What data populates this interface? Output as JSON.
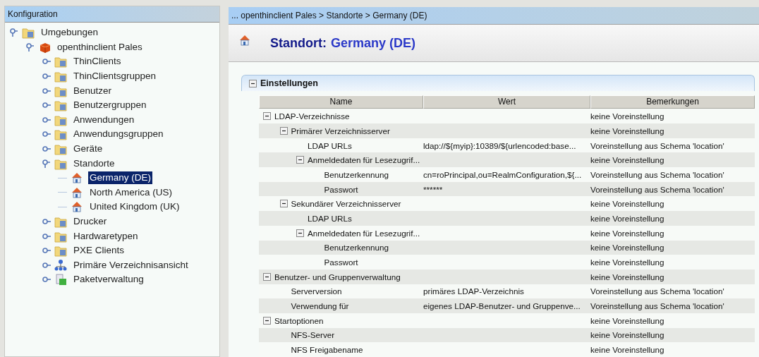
{
  "sidebar": {
    "title": "Konfiguration",
    "tree": [
      {
        "label": "Umgebungen",
        "kind": "folder",
        "expanded": true,
        "selected": false,
        "children": [
          {
            "label": "openthinclient Pales",
            "kind": "cube",
            "expanded": true,
            "selected": false,
            "children": [
              {
                "label": "ThinClients",
                "kind": "folder",
                "expanded": false,
                "selected": false
              },
              {
                "label": "ThinClientsgruppen",
                "kind": "folder",
                "expanded": false,
                "selected": false
              },
              {
                "label": "Benutzer",
                "kind": "folder",
                "expanded": false,
                "selected": false
              },
              {
                "label": "Benutzergruppen",
                "kind": "folder",
                "expanded": false,
                "selected": false
              },
              {
                "label": "Anwendungen",
                "kind": "folder",
                "expanded": false,
                "selected": false
              },
              {
                "label": "Anwendungsgruppen",
                "kind": "folder",
                "expanded": false,
                "selected": false
              },
              {
                "label": "Geräte",
                "kind": "folder",
                "expanded": false,
                "selected": false
              },
              {
                "label": "Standorte",
                "kind": "folder",
                "expanded": true,
                "selected": false,
                "children": [
                  {
                    "label": "Germany (DE)",
                    "kind": "house",
                    "selected": true
                  },
                  {
                    "label": "North America (US)",
                    "kind": "house",
                    "selected": false
                  },
                  {
                    "label": "United Kingdom (UK)",
                    "kind": "house",
                    "selected": false
                  }
                ]
              },
              {
                "label": "Drucker",
                "kind": "folder",
                "expanded": false,
                "selected": false
              },
              {
                "label": "Hardwaretypen",
                "kind": "folder",
                "expanded": false,
                "selected": false
              },
              {
                "label": "PXE Clients",
                "kind": "folder",
                "expanded": false,
                "selected": false
              },
              {
                "label": "Primäre Verzeichnisansicht",
                "kind": "hierarchy",
                "expanded": false,
                "selected": false
              },
              {
                "label": "Paketverwaltung",
                "kind": "package",
                "expanded": false,
                "selected": false
              }
            ]
          }
        ]
      }
    ]
  },
  "breadcrumb": "... openthinclient Pales > Standorte > Germany (DE)",
  "header": {
    "label": "Standort:",
    "value": "Germany (DE)"
  },
  "settings": {
    "title": "Einstellungen",
    "expanded": true,
    "table": {
      "columns": [
        "Name",
        "Wert",
        "Bemerkungen"
      ],
      "rows": [
        {
          "name": "LDAP-Verzeichnisse",
          "remark": "keine Voreinstellung",
          "expanded": true,
          "children": [
            {
              "name": "Primärer Verzeichnisserver",
              "remark": "keine Voreinstellung",
              "expanded": true,
              "children": [
                {
                  "name": "LDAP URLs",
                  "value": "ldap://${myip}:10389/${urlencoded:base...",
                  "remark": "Voreinstellung aus Schema 'location'"
                },
                {
                  "name": "Anmeldedaten für Lesezugrif...",
                  "remark": "keine Voreinstellung",
                  "expanded": true,
                  "children": [
                    {
                      "name": "Benutzerkennung",
                      "value": "cn=roPrincipal,ou=RealmConfiguration,${...",
                      "remark": "Voreinstellung aus Schema 'location'"
                    },
                    {
                      "name": "Passwort",
                      "value": "******",
                      "remark": "Voreinstellung aus Schema 'location'"
                    }
                  ]
                }
              ]
            },
            {
              "name": "Sekundärer Verzeichnisserver",
              "remark": "keine Voreinstellung",
              "expanded": true,
              "children": [
                {
                  "name": "LDAP URLs",
                  "remark": "keine Voreinstellung"
                },
                {
                  "name": "Anmeldedaten für Lesezugrif...",
                  "remark": "keine Voreinstellung",
                  "expanded": true,
                  "children": [
                    {
                      "name": "Benutzerkennung",
                      "remark": "keine Voreinstellung"
                    },
                    {
                      "name": "Passwort",
                      "remark": "keine Voreinstellung"
                    }
                  ]
                }
              ]
            }
          ]
        },
        {
          "name": "Benutzer- und Gruppenverwaltung",
          "remark": "keine Voreinstellung",
          "expanded": true,
          "children": [
            {
              "name": "Serverversion",
              "value": "primäres LDAP-Verzeichnis",
              "remark": "Voreinstellung aus Schema 'location'"
            },
            {
              "name": "Verwendung für",
              "value": "eigenes LDAP-Benutzer- und Gruppenve...",
              "remark": "Voreinstellung aus Schema 'location'"
            }
          ]
        },
        {
          "name": "Startoptionen",
          "remark": "keine Voreinstellung",
          "expanded": true,
          "children": [
            {
              "name": "NFS-Server",
              "remark": "keine Voreinstellung"
            },
            {
              "name": "NFS Freigabename",
              "remark": "keine Voreinstellung"
            }
          ]
        }
      ]
    }
  }
}
